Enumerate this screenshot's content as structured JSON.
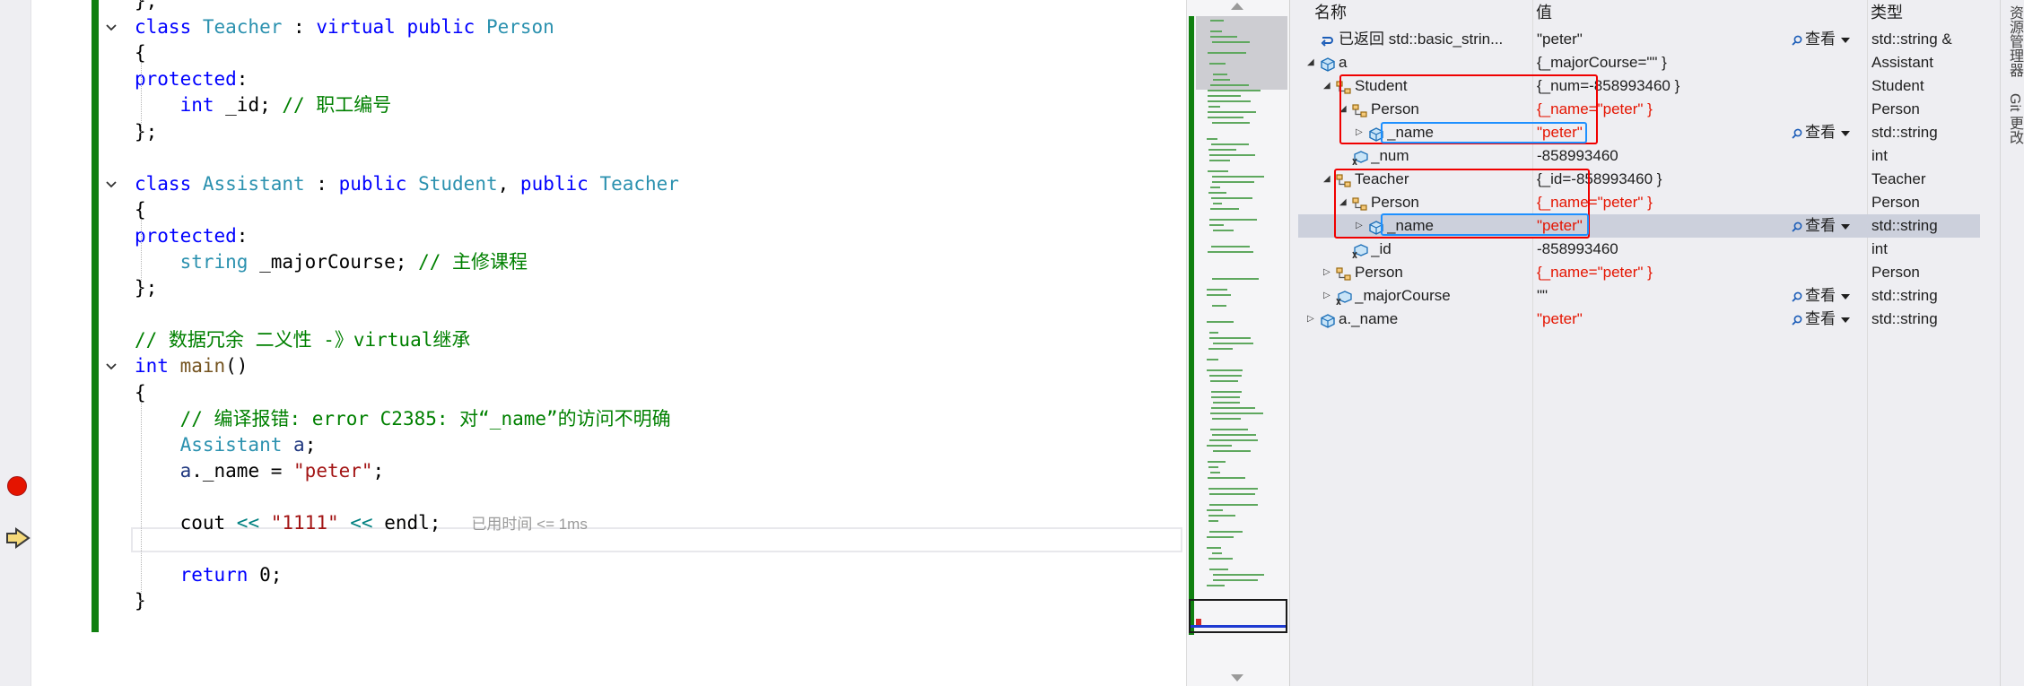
{
  "editor": {
    "lines": [
      {
        "top": 0,
        "segments": [
          {
            "t": "};",
            "c": ""
          }
        ]
      },
      {
        "segments": [
          {
            "t": "class ",
            "c": "kw"
          },
          {
            "t": "Teacher",
            "c": "ty"
          },
          {
            "t": " : ",
            "c": ""
          },
          {
            "t": "virtual public ",
            "c": "kw"
          },
          {
            "t": "Person",
            "c": "ty"
          }
        ]
      },
      {
        "segments": [
          {
            "t": "{",
            "c": ""
          }
        ]
      },
      {
        "segments": [
          {
            "t": "protected",
            "c": "kw"
          },
          {
            "t": ":",
            "c": ""
          }
        ]
      },
      {
        "segments": [
          {
            "t": "    ",
            "c": ""
          },
          {
            "t": "int",
            "c": "kw"
          },
          {
            "t": " _id; ",
            "c": ""
          },
          {
            "t": "// 职工编号",
            "c": "cm"
          }
        ]
      },
      {
        "segments": [
          {
            "t": "};",
            "c": ""
          }
        ]
      },
      {
        "segments": []
      },
      {
        "segments": [
          {
            "t": "class ",
            "c": "kw"
          },
          {
            "t": "Assistant",
            "c": "ty"
          },
          {
            "t": " : ",
            "c": ""
          },
          {
            "t": "public ",
            "c": "kw"
          },
          {
            "t": "Student",
            "c": "ty"
          },
          {
            "t": ", ",
            "c": ""
          },
          {
            "t": "public ",
            "c": "kw"
          },
          {
            "t": "Teacher",
            "c": "ty"
          }
        ]
      },
      {
        "segments": [
          {
            "t": "{",
            "c": ""
          }
        ]
      },
      {
        "segments": [
          {
            "t": "protected",
            "c": "kw"
          },
          {
            "t": ":",
            "c": ""
          }
        ]
      },
      {
        "segments": [
          {
            "t": "    ",
            "c": ""
          },
          {
            "t": "string",
            "c": "ty"
          },
          {
            "t": " _majorCourse; ",
            "c": ""
          },
          {
            "t": "// 主修课程",
            "c": "cm"
          }
        ]
      },
      {
        "segments": [
          {
            "t": "};",
            "c": ""
          }
        ]
      },
      {
        "segments": []
      },
      {
        "segments": [
          {
            "t": "// 数据冗余 二义性 -》virtual继承",
            "c": "cm"
          }
        ]
      },
      {
        "segments": [
          {
            "t": "int ",
            "c": "kw"
          },
          {
            "t": "main",
            "c": "fn"
          },
          {
            "t": "()",
            "c": ""
          }
        ]
      },
      {
        "segments": [
          {
            "t": "{",
            "c": ""
          }
        ]
      },
      {
        "segments": [
          {
            "t": "    ",
            "c": ""
          },
          {
            "t": "// 编译报错: error C2385: 对“_name”的访问不明确",
            "c": "cm"
          }
        ]
      },
      {
        "segments": [
          {
            "t": "    ",
            "c": ""
          },
          {
            "t": "Assistant",
            "c": "ty"
          },
          {
            "t": " ",
            "c": ""
          },
          {
            "t": "a",
            "c": "var"
          },
          {
            "t": ";",
            "c": ""
          }
        ]
      },
      {
        "segments": [
          {
            "t": "    ",
            "c": ""
          },
          {
            "t": "a",
            "c": "var"
          },
          {
            "t": "._name = ",
            "c": ""
          },
          {
            "t": "\"peter\"",
            "c": "str"
          },
          {
            "t": ";",
            "c": ""
          }
        ]
      },
      {
        "segments": []
      },
      {
        "segments": [
          {
            "t": "    cout ",
            "c": ""
          },
          {
            "t": "<<",
            "c": "op"
          },
          {
            "t": " ",
            "c": ""
          },
          {
            "t": "\"1111\"",
            "c": "str"
          },
          {
            "t": " ",
            "c": ""
          },
          {
            "t": "<<",
            "c": "op"
          },
          {
            "t": " endl;",
            "c": ""
          }
        ]
      },
      {
        "segments": []
      },
      {
        "segments": [
          {
            "t": "    ",
            "c": ""
          },
          {
            "t": "return",
            "c": "kw"
          },
          {
            "t": " 0;",
            "c": ""
          }
        ]
      },
      {
        "segments": [
          {
            "t": "}",
            "c": ""
          }
        ]
      }
    ],
    "elapsed": "已用时间 <= 1ms"
  },
  "watch": {
    "headers": {
      "name": "名称",
      "value": "值",
      "type": "类型"
    },
    "view_label": "查看",
    "rows": [
      {
        "indent": 0,
        "expander": "none",
        "icon": "return-icon",
        "name": "已返回 std::basic_strin...",
        "value": "\"peter\"",
        "value_red": false,
        "view": true,
        "type": "std::string &",
        "selected": false
      },
      {
        "indent": 0,
        "expander": "expanded",
        "icon": "object-icon",
        "name": "a",
        "value": "{_majorCourse=\"\" }",
        "value_red": false,
        "view": false,
        "type": "Assistant",
        "selected": false
      },
      {
        "indent": 1,
        "expander": "expanded",
        "icon": "base-class-icon",
        "name": "Student",
        "value": "{_num=-858993460 }",
        "value_red": false,
        "view": false,
        "type": "Student",
        "selected": false
      },
      {
        "indent": 2,
        "expander": "expanded",
        "icon": "base-class-icon",
        "name": "Person",
        "value": "{_name=\"peter\" }",
        "value_red": true,
        "view": false,
        "type": "Person",
        "selected": false
      },
      {
        "indent": 3,
        "expander": "collapsed",
        "icon": "field-icon",
        "name": "_name",
        "value": "\"peter\"",
        "value_red": true,
        "view": true,
        "type": "std::string",
        "selected": false
      },
      {
        "indent": 2,
        "expander": "none",
        "icon": "protected-field-icon",
        "name": "_num",
        "value": "-858993460",
        "value_red": false,
        "view": false,
        "type": "int",
        "selected": false
      },
      {
        "indent": 1,
        "expander": "expanded",
        "icon": "base-class-icon",
        "name": "Teacher",
        "value": "{_id=-858993460 }",
        "value_red": false,
        "view": false,
        "type": "Teacher",
        "selected": false
      },
      {
        "indent": 2,
        "expander": "expanded",
        "icon": "base-class-icon",
        "name": "Person",
        "value": "{_name=\"peter\" }",
        "value_red": true,
        "view": false,
        "type": "Person",
        "selected": false
      },
      {
        "indent": 3,
        "expander": "collapsed",
        "icon": "field-icon",
        "name": "_name",
        "value": "\"peter\"",
        "value_red": true,
        "view": true,
        "type": "std::string",
        "selected": true
      },
      {
        "indent": 2,
        "expander": "none",
        "icon": "protected-field-icon",
        "name": "_id",
        "value": "-858993460",
        "value_red": false,
        "view": false,
        "type": "int",
        "selected": false
      },
      {
        "indent": 1,
        "expander": "collapsed",
        "icon": "base-class-icon",
        "name": "Person",
        "value": "{_name=\"peter\" }",
        "value_red": true,
        "view": false,
        "type": "Person",
        "selected": false
      },
      {
        "indent": 1,
        "expander": "collapsed",
        "icon": "protected-field-icon",
        "name": "_majorCourse",
        "value": "\"\"",
        "value_red": false,
        "view": true,
        "type": "std::string",
        "selected": false
      },
      {
        "indent": 0,
        "expander": "collapsed",
        "icon": "object-icon",
        "name": "a._name",
        "value": "\"peter\"",
        "value_red": true,
        "view": true,
        "type": "std::string",
        "selected": false
      }
    ]
  },
  "side_tabs": [
    "资源管理器",
    "Git 更改"
  ]
}
